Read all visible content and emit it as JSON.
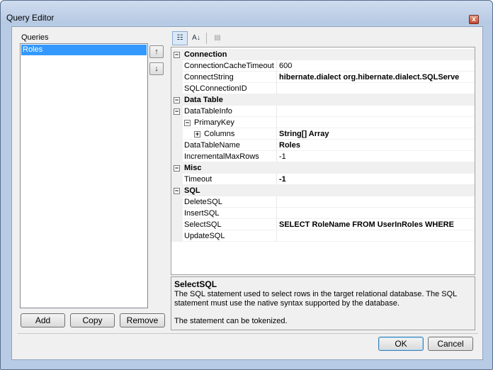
{
  "window": {
    "title": "Query Editor",
    "close_glyph": "x"
  },
  "queries": {
    "label": "Queries",
    "items": [
      "Roles"
    ],
    "move_up_glyph": "↑",
    "move_down_glyph": "↓",
    "add_label": "Add",
    "copy_label": "Copy",
    "remove_label": "Remove"
  },
  "toolbar": {
    "categorized_glyph": "☷",
    "alphabetical_glyph": "A↓",
    "property_pages_glyph": "▤"
  },
  "grid": {
    "cat_connection": "Connection",
    "connection_cache_timeout_name": "ConnectionCacheTimeout",
    "connection_cache_timeout_value": "600",
    "connect_string_name": "ConnectString",
    "connect_string_value": "hibernate.dialect org.hibernate.dialect.SQLServe",
    "sql_connection_id_name": "SQLConnectionID",
    "sql_connection_id_value": "",
    "cat_data_table": "Data Table",
    "data_table_info_name": "DataTableInfo",
    "primary_key_name": "PrimaryKey",
    "columns_name": "Columns",
    "columns_value": "String[] Array",
    "data_table_name_name": "DataTableName",
    "data_table_name_value": "Roles",
    "incremental_max_rows_name": "IncrementalMaxRows",
    "incremental_max_rows_value": "-1",
    "cat_misc": "Misc",
    "timeout_name": "Timeout",
    "timeout_value": "-1",
    "cat_sql": "SQL",
    "delete_sql_name": "DeleteSQL",
    "insert_sql_name": "InsertSQL",
    "select_sql_name": "SelectSQL",
    "select_sql_value": "SELECT RoleName FROM UserInRoles WHERE",
    "update_sql_name": "UpdateSQL",
    "collapse_glyph": "−",
    "expand_glyph": "+"
  },
  "description": {
    "title": "SelectSQL",
    "text": "The SQL statement used to select rows in the target relational database.  The SQL statement must use the native syntax supported by the database.",
    "note": "The statement can be tokenized."
  },
  "buttons": {
    "ok_label": "OK",
    "cancel_label": "Cancel"
  }
}
